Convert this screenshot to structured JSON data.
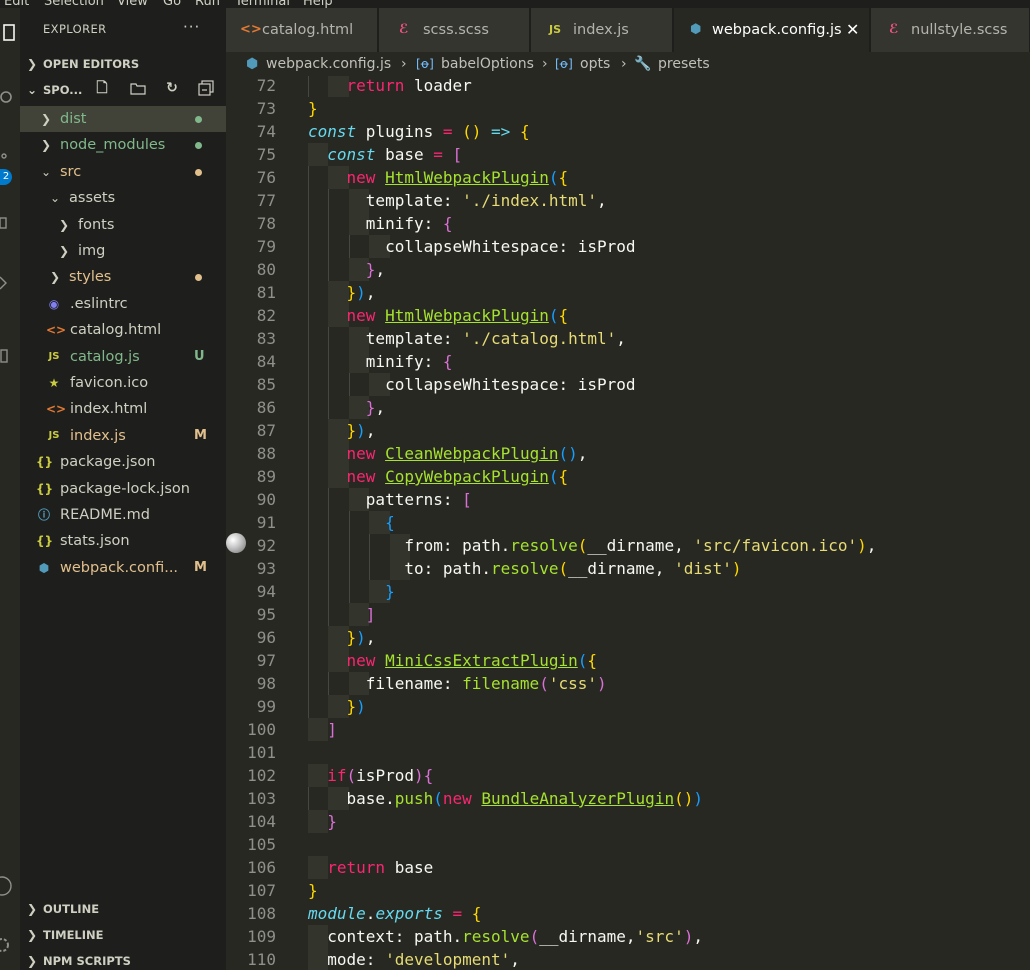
{
  "menubar": [
    "Edit",
    "Selection",
    "View",
    "Go",
    "Run",
    "Terminal",
    "Help"
  ],
  "activity": {
    "badge": "2"
  },
  "sidebar": {
    "title": "EXPLORER",
    "more": "···",
    "open_editors": "OPEN EDITORS",
    "project": "SPO...",
    "tree": [
      {
        "label": "dist",
        "type": "folder",
        "deco": "dot",
        "color": "#81b88b"
      },
      {
        "label": "node_modules",
        "type": "folder",
        "deco": "dot",
        "color": "#81b88b"
      },
      {
        "label": "src",
        "type": "folder-open",
        "deco": "dot",
        "color": "#e2c08d"
      },
      {
        "label": "assets",
        "type": "folder-open"
      },
      {
        "label": "fonts",
        "type": "folder"
      },
      {
        "label": "img",
        "type": "folder"
      },
      {
        "label": "styles",
        "type": "folder",
        "deco": "dot",
        "color": "#e2c08d"
      },
      {
        "label": ".eslintrc",
        "type": "eslint"
      },
      {
        "label": "catalog.html",
        "type": "html"
      },
      {
        "label": "catalog.js",
        "type": "js",
        "deco": "U",
        "color": "#81b88b"
      },
      {
        "label": "favicon.ico",
        "type": "star"
      },
      {
        "label": "index.html",
        "type": "html"
      },
      {
        "label": "index.js",
        "type": "js",
        "deco": "M",
        "color": "#e2c08d"
      },
      {
        "label": "package.json",
        "type": "json"
      },
      {
        "label": "package-lock.json",
        "type": "json"
      },
      {
        "label": "README.md",
        "type": "info"
      },
      {
        "label": "stats.json",
        "type": "json"
      },
      {
        "label": "webpack.confi...",
        "type": "webpack",
        "deco": "M",
        "color": "#e2c08d"
      }
    ],
    "outline": "OUTLINE",
    "timeline": "TIMELINE",
    "npm": "NPM SCRIPTS"
  },
  "tabs": [
    {
      "label": "catalog.html",
      "icon": "<>",
      "active": false
    },
    {
      "label": "scss.scss",
      "icon": "scss",
      "active": false
    },
    {
      "label": "index.js",
      "icon": "JS",
      "active": false
    },
    {
      "label": "webpack.config.js",
      "icon": "webpack",
      "active": true
    },
    {
      "label": "nullstyle.scss",
      "icon": "scss",
      "active": false
    }
  ],
  "breadcrumb": [
    "webpack.config.js",
    "babelOptions",
    "opts",
    "presets"
  ],
  "editor": {
    "first_line": 72,
    "lines": [
      [
        [
          "    ",
          "p"
        ],
        [
          "return",
          "k"
        ],
        [
          " loader",
          "p"
        ]
      ],
      [
        [
          "}",
          "br1"
        ]
      ],
      [
        [
          "const",
          "it"
        ],
        [
          " plugins ",
          "p"
        ],
        [
          "=",
          "k"
        ],
        [
          " () ",
          "br1"
        ],
        [
          "=>",
          "it"
        ],
        [
          " ",
          "p"
        ],
        [
          "{",
          "br1"
        ]
      ],
      [
        [
          "  ",
          "p"
        ],
        [
          "const",
          "it"
        ],
        [
          " base ",
          "p"
        ],
        [
          "=",
          "k"
        ],
        [
          " ",
          "p"
        ],
        [
          "[",
          "br2"
        ]
      ],
      [
        [
          "    ",
          "p"
        ],
        [
          "new",
          "k"
        ],
        [
          " ",
          "p"
        ],
        [
          "HtmlWebpackPlugin",
          "u"
        ],
        [
          "(",
          "br3"
        ],
        [
          "{",
          "br1"
        ]
      ],
      [
        [
          "      template: ",
          "p"
        ],
        [
          "'./index.html'",
          "s"
        ],
        [
          ",",
          "p"
        ]
      ],
      [
        [
          "      minify: ",
          "p"
        ],
        [
          "{",
          "br2"
        ]
      ],
      [
        [
          "        collapseWhitespace: isProd",
          "p"
        ]
      ],
      [
        [
          "      ",
          "p"
        ],
        [
          "}",
          "br2"
        ],
        [
          ",",
          "p"
        ]
      ],
      [
        [
          "    ",
          "p"
        ],
        [
          "}",
          "br1"
        ],
        [
          ")",
          "br3"
        ],
        [
          ",",
          "p"
        ]
      ],
      [
        [
          "    ",
          "p"
        ],
        [
          "new",
          "k"
        ],
        [
          " ",
          "p"
        ],
        [
          "HtmlWebpackPlugin",
          "u"
        ],
        [
          "(",
          "br3"
        ],
        [
          "{",
          "br1"
        ]
      ],
      [
        [
          "      template: ",
          "p"
        ],
        [
          "'./catalog.html'",
          "s"
        ],
        [
          ",",
          "p"
        ]
      ],
      [
        [
          "      minify: ",
          "p"
        ],
        [
          "{",
          "br2"
        ]
      ],
      [
        [
          "        collapseWhitespace: isProd",
          "p"
        ]
      ],
      [
        [
          "      ",
          "p"
        ],
        [
          "}",
          "br2"
        ],
        [
          ",",
          "p"
        ]
      ],
      [
        [
          "    ",
          "p"
        ],
        [
          "}",
          "br1"
        ],
        [
          ")",
          "br3"
        ],
        [
          ",",
          "p"
        ]
      ],
      [
        [
          "    ",
          "p"
        ],
        [
          "new",
          "k"
        ],
        [
          " ",
          "p"
        ],
        [
          "CleanWebpackPlugin",
          "u"
        ],
        [
          "()",
          "br3"
        ],
        [
          ",",
          "p"
        ]
      ],
      [
        [
          "    ",
          "p"
        ],
        [
          "new",
          "k"
        ],
        [
          " ",
          "p"
        ],
        [
          "CopyWebpackPlugin",
          "u"
        ],
        [
          "(",
          "br3"
        ],
        [
          "{",
          "br1"
        ]
      ],
      [
        [
          "      patterns: ",
          "p"
        ],
        [
          "[",
          "br2"
        ]
      ],
      [
        [
          "        ",
          "p"
        ],
        [
          "{",
          "br3"
        ]
      ],
      [
        [
          "          from: path.",
          "p"
        ],
        [
          "resolve",
          "f"
        ],
        [
          "(",
          "br1"
        ],
        [
          "__dirname, ",
          "p"
        ],
        [
          "'src/favicon.ico'",
          "s"
        ],
        [
          ")",
          "br1"
        ],
        [
          ",",
          "p"
        ]
      ],
      [
        [
          "          to: path.",
          "p"
        ],
        [
          "resolve",
          "f"
        ],
        [
          "(",
          "br1"
        ],
        [
          "__dirname, ",
          "p"
        ],
        [
          "'dist'",
          "s"
        ],
        [
          ")",
          "br1"
        ]
      ],
      [
        [
          "        ",
          "p"
        ],
        [
          "}",
          "br3"
        ]
      ],
      [
        [
          "      ",
          "p"
        ],
        [
          "]",
          "br2"
        ]
      ],
      [
        [
          "    ",
          "p"
        ],
        [
          "}",
          "br1"
        ],
        [
          ")",
          "br3"
        ],
        [
          ",",
          "p"
        ]
      ],
      [
        [
          "    ",
          "p"
        ],
        [
          "new",
          "k"
        ],
        [
          " ",
          "p"
        ],
        [
          "MiniCssExtractPlugin",
          "u"
        ],
        [
          "(",
          "br3"
        ],
        [
          "{",
          "br1"
        ]
      ],
      [
        [
          "      filename: ",
          "p"
        ],
        [
          "filename",
          "f"
        ],
        [
          "(",
          "br2"
        ],
        [
          "'css'",
          "s"
        ],
        [
          ")",
          "br2"
        ]
      ],
      [
        [
          "    ",
          "p"
        ],
        [
          "}",
          "br1"
        ],
        [
          ")",
          "br3"
        ]
      ],
      [
        [
          "  ",
          "p"
        ],
        [
          "]",
          "br2"
        ]
      ],
      [
        [
          "",
          "p"
        ]
      ],
      [
        [
          "  ",
          "p"
        ],
        [
          "if",
          "k"
        ],
        [
          "(",
          "br2"
        ],
        [
          "isProd",
          "p"
        ],
        [
          ")",
          "br2"
        ],
        [
          "{",
          "br2"
        ]
      ],
      [
        [
          "    base.",
          "p"
        ],
        [
          "push",
          "f"
        ],
        [
          "(",
          "br3"
        ],
        [
          "new",
          "k"
        ],
        [
          " ",
          "p"
        ],
        [
          "BundleAnalyzerPlugin",
          "u"
        ],
        [
          "()",
          "br1"
        ],
        [
          ")",
          "br3"
        ]
      ],
      [
        [
          "  ",
          "p"
        ],
        [
          "}",
          "br2"
        ]
      ],
      [
        [
          "",
          "p"
        ]
      ],
      [
        [
          "  ",
          "p"
        ],
        [
          "return",
          "k"
        ],
        [
          " base",
          "p"
        ]
      ],
      [
        [
          "}",
          "br1"
        ]
      ],
      [
        [
          "module",
          "it"
        ],
        [
          ".",
          "p"
        ],
        [
          "exports",
          "it"
        ],
        [
          " ",
          "p"
        ],
        [
          "=",
          "k"
        ],
        [
          " ",
          "p"
        ],
        [
          "{",
          "br1"
        ]
      ],
      [
        [
          "  context: path.",
          "p"
        ],
        [
          "resolve",
          "f"
        ],
        [
          "(",
          "br2"
        ],
        [
          "__dirname,",
          "p"
        ],
        [
          "'src'",
          "s"
        ],
        [
          ")",
          "br2"
        ],
        [
          ",",
          "p"
        ]
      ],
      [
        [
          "  mode: ",
          "p"
        ],
        [
          "'development'",
          "s"
        ],
        [
          ",",
          "p"
        ]
      ]
    ]
  }
}
